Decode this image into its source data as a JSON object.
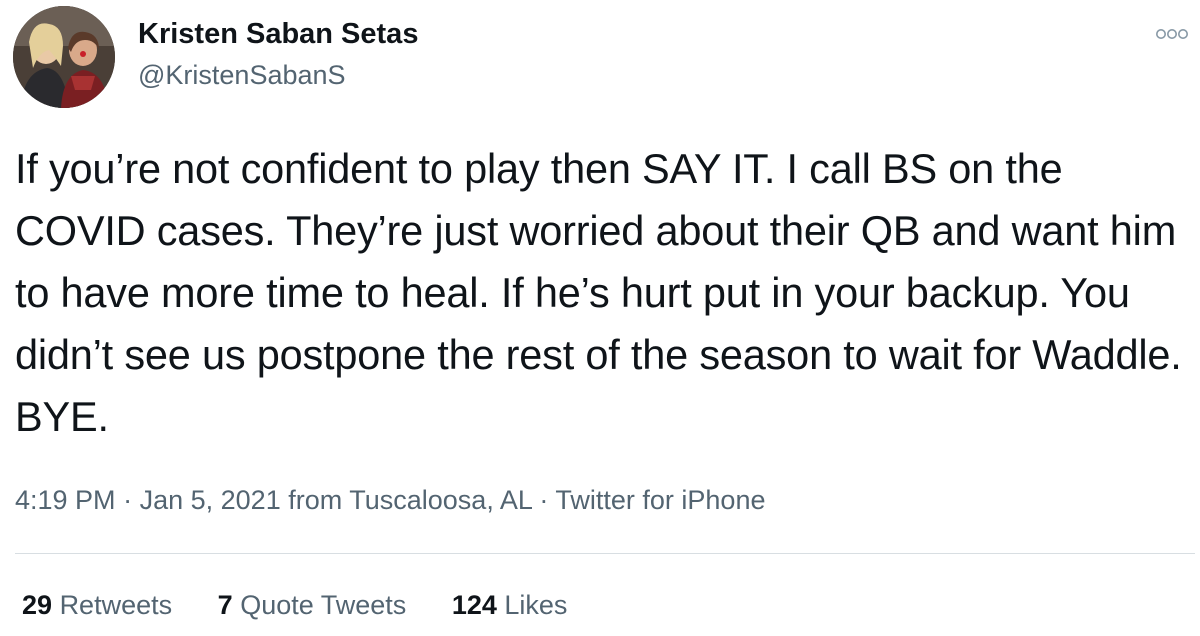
{
  "user": {
    "display_name": "Kristen Saban Setas",
    "handle": "@KristenSabanS"
  },
  "tweet": {
    "text": "If you’re not confident to play then SAY IT. I call BS on the COVID cases. They’re just worried about their QB and want him to have more time to heal. If he’s hurt put in your backup. You didn’t see us postpone the rest of the season to wait for Waddle. BYE.",
    "time": "4:19 PM",
    "date": "Jan 5, 2021",
    "location": "from Tuscaloosa, AL",
    "source": "Twitter for iPhone",
    "separator": "·"
  },
  "stats": {
    "retweets_count": "29",
    "retweets_label": "Retweets",
    "quotes_count": "7",
    "quotes_label": "Quote Tweets",
    "likes_count": "124",
    "likes_label": "Likes"
  },
  "icons": {
    "more": "more-options-icon"
  }
}
